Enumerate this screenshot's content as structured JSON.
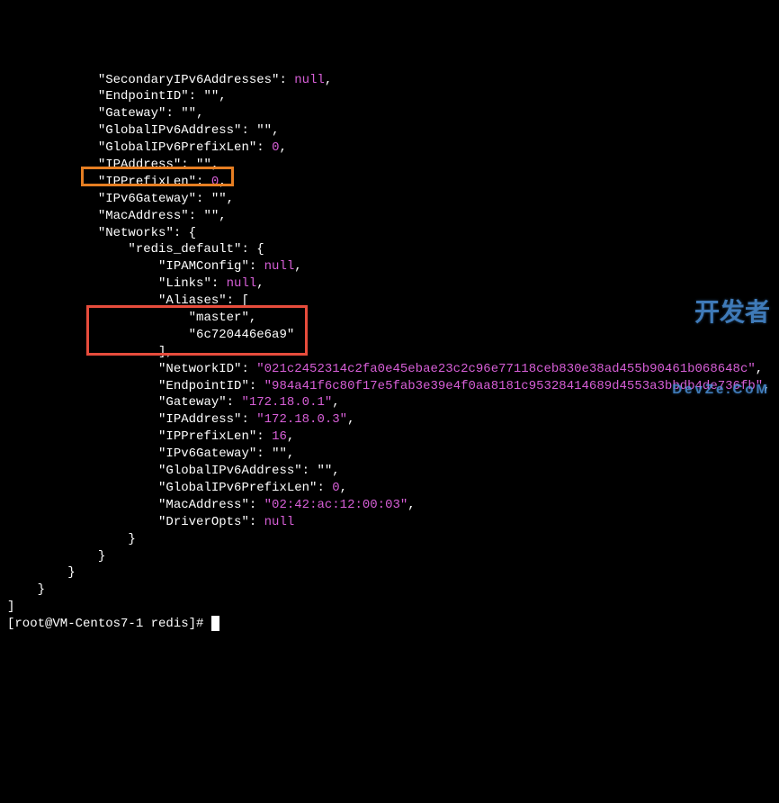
{
  "indent": {
    "l1": "            ",
    "l2": "                ",
    "l3": "                    ",
    "l4": "                        "
  },
  "json_output": {
    "SecondaryIPv6Addresses": "null",
    "EndpointID": "\"\"",
    "Gateway": "\"\"",
    "GlobalIPv6Address": "\"\"",
    "GlobalIPv6PrefixLen": "0",
    "IPAddress": "\"\"",
    "IPPrefixLen": "0",
    "IPv6Gateway": "\"\"",
    "MacAddress": "\"\"",
    "Networks_label": "\"Networks\"",
    "network_name": "\"redis_default\"",
    "inner": {
      "IPAMConfig": "null",
      "Links": "null",
      "Aliases_label": "\"Aliases\"",
      "aliases": [
        "\"master\"",
        "\"6c720446e6a9\""
      ],
      "NetworkID": "\"021c2452314c2fa0e45ebae23c2c96e77118ceb830e38ad455b90461b068648c\"",
      "EndpointID": "\"984a41f6c80f17e5fab3e39e4f0aa8181c95328414689d4553a3bbdb4de736fb\"",
      "Gateway": "\"172.18.0.1\"",
      "IPAddress": "\"172.18.0.3\"",
      "IPPrefixLen": "16",
      "IPv6Gateway": "\"\"",
      "GlobalIPv6Address": "\"\"",
      "GlobalIPv6PrefixLen": "0",
      "MacAddress": "\"02:42:ac:12:00:03\"",
      "DriverOpts": "null"
    }
  },
  "prompt": "[root@VM-Centos7-1 redis]# ",
  "watermark": {
    "main": "开发者",
    "sub": "DevZe.CoM"
  }
}
